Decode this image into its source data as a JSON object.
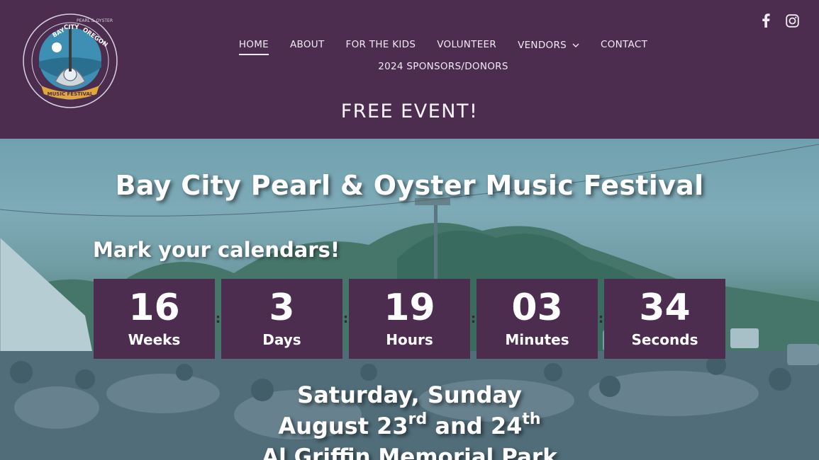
{
  "logo": {
    "top_text": "BAY CITY OREGON",
    "ring_text": "PEARL & OYSTER",
    "banner_text": "MUSIC FESTIVAL"
  },
  "social": [
    {
      "icon": "facebook-icon",
      "glyph": "f"
    },
    {
      "icon": "instagram-icon",
      "glyph": ""
    }
  ],
  "nav": {
    "items": [
      {
        "label": "HOME",
        "active": true
      },
      {
        "label": "ABOUT"
      },
      {
        "label": "FOR THE KIDS"
      },
      {
        "label": "VOLUNTEER"
      },
      {
        "label": "VENDORS",
        "has_dropdown": true
      },
      {
        "label": "CONTACT"
      }
    ],
    "row2": "2024 SPONSORS/DONORS"
  },
  "free_event": "FREE EVENT!",
  "hero": {
    "title": "Bay City Pearl & Oyster Music Festival",
    "mark": "Mark your calendars!",
    "countdown": [
      {
        "value": "16",
        "label": "Weeks"
      },
      {
        "value": "3",
        "label": "Days"
      },
      {
        "value": "19",
        "label": "Hours"
      },
      {
        "value": "03",
        "label": "Minutes"
      },
      {
        "value": "34",
        "label": "Seconds"
      }
    ],
    "separator": ":",
    "dates": {
      "line1": "Saturday, Sunday",
      "month": "August 23",
      "sup1": "rd",
      "and": " and 24",
      "sup2": "th",
      "line3": "Al Griffin Memorial Park"
    }
  },
  "colors": {
    "header_bg": "#4c2d50",
    "countdown_bg": "#4c2d50",
    "text": "#ffffff"
  }
}
